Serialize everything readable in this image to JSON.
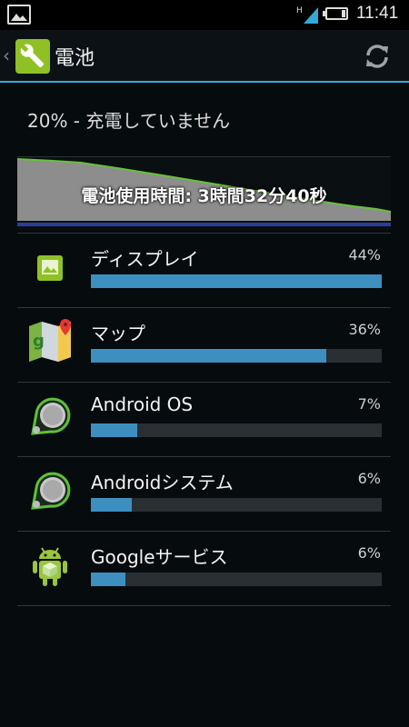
{
  "status_bar": {
    "time": "11:41",
    "network_type": "H",
    "icons": [
      "gallery-notification-icon",
      "signal-icon",
      "battery-icon"
    ]
  },
  "action_bar": {
    "back_glyph": "‹",
    "title": "電池",
    "app_icon": "settings-wrench-icon",
    "refresh_icon": "refresh-icon"
  },
  "summary": {
    "text": "20% - 充電していません"
  },
  "graph": {
    "label": "電池使用時間: 3時間32分40秒",
    "line_color": "#66c23a"
  },
  "apps": [
    {
      "name": "ディスプレイ",
      "percent_label": "44%",
      "fraction": 1.0,
      "icon": "display-icon"
    },
    {
      "name": "マップ",
      "percent_label": "36%",
      "fraction": 0.81,
      "icon": "maps-icon"
    },
    {
      "name": "Android OS",
      "percent_label": "7%",
      "fraction": 0.16,
      "icon": "android-os-icon"
    },
    {
      "name": "Androidシステム",
      "percent_label": "6%",
      "fraction": 0.14,
      "icon": "android-system-icon"
    },
    {
      "name": "Googleサービス",
      "percent_label": "6%",
      "fraction": 0.12,
      "icon": "google-services-icon"
    }
  ],
  "colors": {
    "accent": "#33a9d6",
    "usage_bar": "#3d8fc0",
    "settings_icon_green": "#8fc126"
  }
}
